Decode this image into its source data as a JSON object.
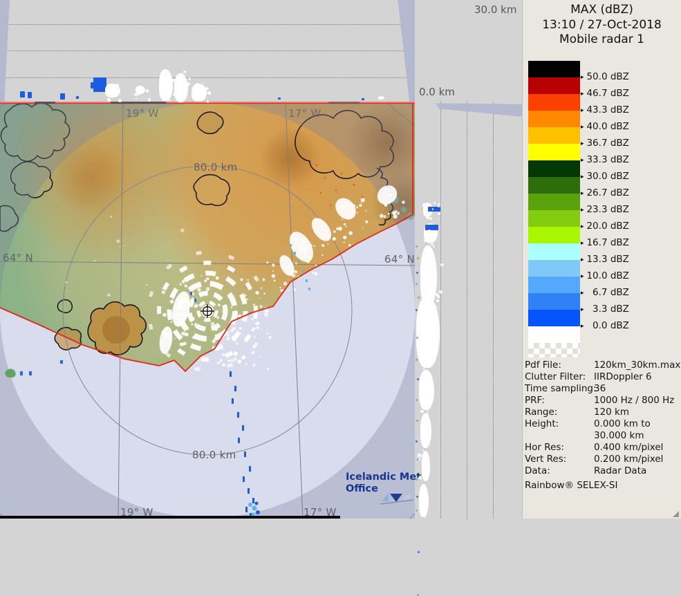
{
  "panel": {
    "title": "MAX (dBZ)",
    "datetime": "13:10 / 27-Oct-2018",
    "radar_name": "Mobile radar 1",
    "tick_glyph": "▸",
    "legend": [
      {
        "color": "#000000",
        "value": "50.0",
        "unit": "dBZ"
      },
      {
        "color": "#b80000",
        "value": "46.7",
        "unit": "dBZ"
      },
      {
        "color": "#fc4000",
        "value": "43.3",
        "unit": "dBZ"
      },
      {
        "color": "#ff8800",
        "value": "40.0",
        "unit": "dBZ"
      },
      {
        "color": "#ffc000",
        "value": "36.7",
        "unit": "dBZ"
      },
      {
        "color": "#ffff00",
        "value": "33.3",
        "unit": "dBZ"
      },
      {
        "color": "#043804",
        "value": "30.0",
        "unit": "dBZ"
      },
      {
        "color": "#2e6e0a",
        "value": "26.7",
        "unit": "dBZ"
      },
      {
        "color": "#5aa30c",
        "value": "23.3",
        "unit": "dBZ"
      },
      {
        "color": "#84cc10",
        "value": "20.0",
        "unit": "dBZ"
      },
      {
        "color": "#aaf500",
        "value": "16.7",
        "unit": "dBZ"
      },
      {
        "color": "#aaffff",
        "value": "13.3",
        "unit": "dBZ"
      },
      {
        "color": "#80c8f8",
        "value": "10.0",
        "unit": "dBZ"
      },
      {
        "color": "#55a8fc",
        "value": "6.7",
        "unit": "dBZ"
      },
      {
        "color": "#3080f8",
        "value": "3.3",
        "unit": "dBZ"
      },
      {
        "color": "#0555fc",
        "value": "0.0",
        "unit": "dBZ"
      }
    ],
    "below_threshold_color": "#ffffff",
    "metadata": [
      {
        "label": "Pdf File:",
        "value": "120km_30km.max"
      },
      {
        "label": "Clutter Filter:",
        "value": "IIRDoppler 6"
      },
      {
        "label": "Time sampling:",
        "value": "36"
      },
      {
        "label": "PRF:",
        "value": "1000 Hz / 800 Hz"
      },
      {
        "label": "Range:",
        "value": "120 km"
      },
      {
        "label": "Height:",
        "value": "0.000 km to"
      },
      {
        "label": "",
        "value": "30.000 km"
      },
      {
        "label": "Hor Res:",
        "value": "0.400 km/pixel"
      },
      {
        "label": "Vert Res:",
        "value": "0.200 km/pixel"
      },
      {
        "label": "Data:",
        "value": "Radar Data"
      }
    ],
    "footer": "Rainbow® SELEX-SI"
  },
  "axes": {
    "max_height_label": "30.0 km",
    "origin_height_label": "0.0 km"
  },
  "map": {
    "range_ring_label_top": "80.0 km",
    "range_ring_label_bottom": "80.0 km",
    "lat_label_left": "64° N",
    "lat_label_right": "64° N",
    "lon19_label_top": "19° W",
    "lon17_label_top": "17° W",
    "lon19_label_bottom": "19° W",
    "lon17_label_bottom": "17° W",
    "logo_line1": "Icelandic Met",
    "logo_line2": "Office",
    "colors": {
      "sea": "#d9dcec",
      "land": "#8cb288",
      "out_of_range_dim": "rgba(120,128,160,0.32)",
      "data_border_red": "#e02818",
      "echo_blue": "#1d5ce0"
    }
  }
}
